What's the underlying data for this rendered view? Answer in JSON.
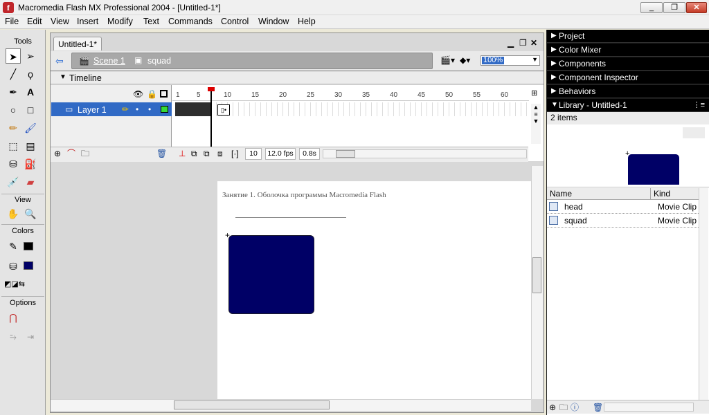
{
  "window": {
    "title": "Macromedia Flash MX Professional 2004 - [Untitled-1*]",
    "controls": [
      "_",
      "❐",
      "✕"
    ]
  },
  "menu": [
    "File",
    "Edit",
    "View",
    "Insert",
    "Modify",
    "Text",
    "Commands",
    "Control",
    "Window",
    "Help"
  ],
  "tools": {
    "heading": "Tools",
    "view_heading": "View",
    "colors_heading": "Colors",
    "options_heading": "Options",
    "stroke_color": "#000000",
    "fill_color": "#000066"
  },
  "document": {
    "tab": "Untitled-1*",
    "scene": "Scene 1",
    "symbol": "squad",
    "zoom": "100%"
  },
  "timeline": {
    "label": "Timeline",
    "layer": "Layer 1",
    "ruler": [
      "1",
      "5",
      "10",
      "15",
      "20",
      "25",
      "30",
      "35",
      "40",
      "45",
      "50",
      "55",
      "60"
    ],
    "current_frame": "10",
    "frame_rate": "12.0 fps",
    "elapsed": "0.8s"
  },
  "stage": {
    "caption": "Занятие 1. Оболочка программы Macromedia Flash",
    "shape_color": "#000066"
  },
  "panels": [
    {
      "label": "Project",
      "state": "collapsed"
    },
    {
      "label": "Color Mixer",
      "state": "collapsed"
    },
    {
      "label": "Components",
      "state": "collapsed"
    },
    {
      "label": "Component Inspector",
      "state": "collapsed"
    },
    {
      "label": "Behaviors",
      "state": "collapsed"
    }
  ],
  "library": {
    "title": "Library - Untitled-1",
    "count": "2 items",
    "columns": {
      "name": "Name",
      "kind": "Kind"
    },
    "items": [
      {
        "name": "head",
        "kind": "Movie Clip"
      },
      {
        "name": "squad",
        "kind": "Movie Clip"
      }
    ]
  }
}
